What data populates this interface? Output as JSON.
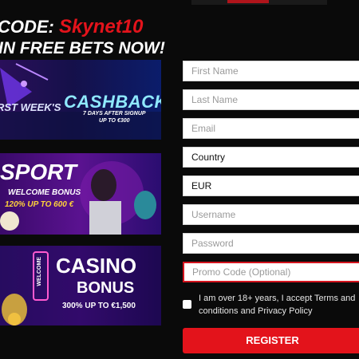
{
  "promo": {
    "code_label": "CODE:",
    "code_value": "Skynet10",
    "subline": "IN FREE BETS NOW!"
  },
  "banners": [
    {
      "title": "CASHBACK",
      "pretitle": "RST WEEK'S",
      "line1": "7 DAYS AFTER SIGNUP",
      "line2": "UP TO €300"
    },
    {
      "title": "SPORT",
      "line1": "WELCOME BONUS",
      "line2": "120% UP TO 600 €"
    },
    {
      "title": "CASINO",
      "vertical": "WELCOME",
      "subtitle": "BONUS",
      "line1": "300% UP TO €1,500"
    }
  ],
  "form": {
    "first_name": {
      "placeholder": "First Name"
    },
    "last_name": {
      "placeholder": "Last Name"
    },
    "email": {
      "placeholder": "Email"
    },
    "country": {
      "value": "Country"
    },
    "currency": {
      "value": "EUR"
    },
    "username": {
      "placeholder": "Username"
    },
    "password": {
      "placeholder": "Password"
    },
    "promo_code": {
      "placeholder": "Promo Code (Optional)"
    },
    "terms_text": "I am over 18+ years, I accept Terms and conditions and Privacy Policy",
    "register_label": "REGISTER"
  },
  "colors": {
    "accent": "#e3131b",
    "background": "#0a0a0a"
  }
}
